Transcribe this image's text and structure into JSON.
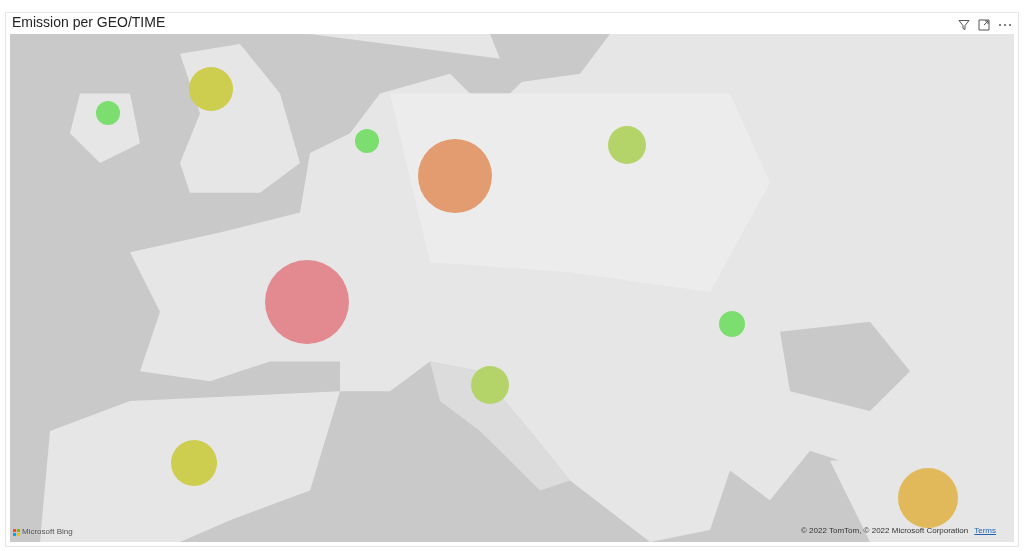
{
  "visual": {
    "title": "Emission per GEO/TIME"
  },
  "bubbles": [
    {
      "color": "#cdcd4f"
    },
    {
      "color": "#7bde6e"
    },
    {
      "color": "#7bde6e"
    },
    {
      "color": "#e29c70"
    },
    {
      "color": "#b4d46a"
    },
    {
      "color": "#e28a90"
    },
    {
      "color": "#7bde6e"
    },
    {
      "color": "#b4d46a"
    },
    {
      "color": "#cdcd4f"
    },
    {
      "color": "#e2b95a"
    }
  ],
  "attribution": {
    "logo": "Microsoft Bing",
    "copyright": "© 2022 TomTom, © 2022 Microsoft Corporation",
    "terms": "Terms"
  }
}
